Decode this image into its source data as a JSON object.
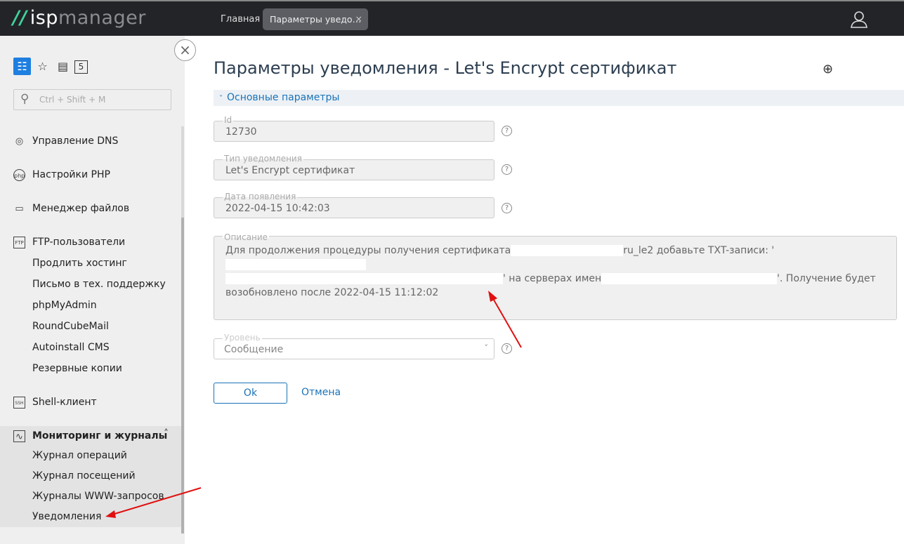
{
  "header": {
    "logo_mark": "//",
    "logo_a": "isp",
    "logo_b": "manager",
    "tab_home": "Главная",
    "tab_active": "Параметры уведо…",
    "tab_close": "×"
  },
  "sidebar": {
    "toolbar_badge": "5",
    "search_placeholder": "Ctrl + Shift + M",
    "items": [
      {
        "label": "Управление DNS",
        "icon": "globe-icon"
      },
      {
        "label": "Настройки PHP",
        "icon": "php-icon"
      },
      {
        "label": "Менеджер файлов",
        "icon": "folder-icon"
      },
      {
        "label": "FTP-пользователи",
        "icon": "ftp-icon"
      },
      {
        "label": "Продлить хостинг"
      },
      {
        "label": "Письмо в тех. поддержку"
      },
      {
        "label": "phpMyAdmin"
      },
      {
        "label": "RoundCubeMail"
      },
      {
        "label": "Autoinstall CMS"
      },
      {
        "label": "Резервные копии"
      },
      {
        "label": "Shell-клиент",
        "icon": "ssh-icon"
      }
    ],
    "monitoring": {
      "label": "Мониторинг и журналы",
      "items": [
        "Журнал операций",
        "Журнал посещений",
        "Журналы WWW-запросов",
        "Уведомления"
      ]
    }
  },
  "form": {
    "title": "Параметры уведомления - Let's Encrypt сертификат",
    "section": "Основные параметры",
    "id_label": "Id",
    "id_value": "12730",
    "type_label": "Тип уведомления",
    "type_value": "Let's Encrypt сертификат",
    "date_label": "Дата появления",
    "date_value": "2022-04-15 10:42:03",
    "desc_label": "Описание",
    "desc_parts": [
      "Для продолжения процедуры получения сертификата",
      "ru_le2 добавьте TXT-записи: '",
      "' на серверах имен",
      "'. Получение будет возобновлено после 2022-04-15 11:12:02"
    ],
    "level_label": "Уровень",
    "level_value": "Сообщение",
    "ok": "Ok",
    "cancel": "Отмена",
    "help": "?"
  }
}
